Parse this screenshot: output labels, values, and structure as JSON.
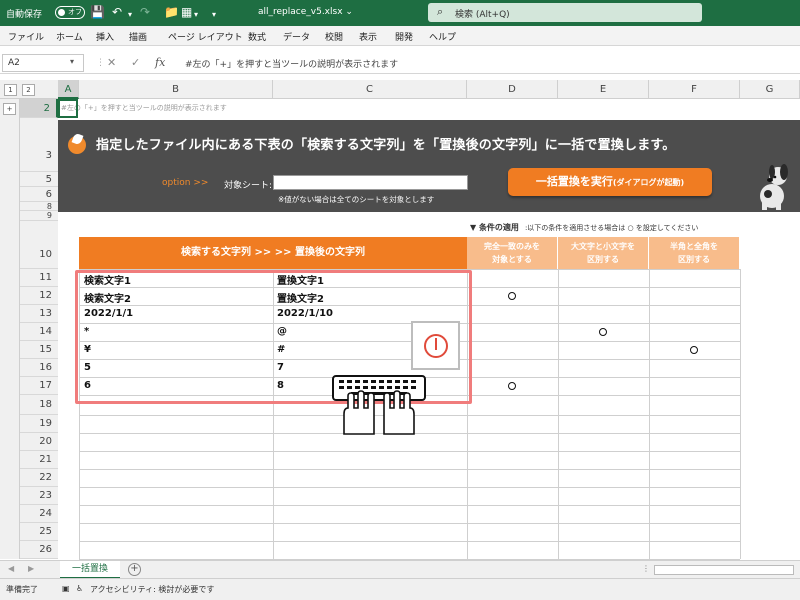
{
  "titlebar": {
    "autosave_label": "自動保存",
    "autosave_state": "オフ",
    "filename": "all_replace_v5.xlsx",
    "search_placeholder": "検索 (Alt+Q)"
  },
  "menu": [
    "ファイル",
    "ホーム",
    "挿入",
    "描画",
    "ページ レイアウト",
    "数式",
    "データ",
    "校閲",
    "表示",
    "開発",
    "ヘルプ"
  ],
  "formula_bar": {
    "name_box": "A2",
    "fx": "fx",
    "content": "#左の「+」を押すと当ツールの説明が表示されます"
  },
  "outline": {
    "level1": "1",
    "level2": "2",
    "expand": "+"
  },
  "columns": [
    "A",
    "B",
    "C",
    "D",
    "E",
    "F",
    "G"
  ],
  "rows": [
    "2",
    "3",
    "5",
    "6",
    "8",
    "9",
    "10",
    "11",
    "12",
    "13",
    "14",
    "15",
    "16",
    "17",
    "18",
    "19",
    "20",
    "21",
    "22",
    "23",
    "24",
    "25",
    "26"
  ],
  "sheet": {
    "a2_note": "#左の「+」を押すと当ツールの説明が表示されます",
    "heading": "指定したファイル内にある下表の「検索する文字列」を「置換後の文字列」に一括で置換します。",
    "option_label": "option >>",
    "target_sheet_label": "対象シート:",
    "target_sheet_hint": "※値がない場合は全てのシートを対象とします",
    "run_button": "一括置換を実行",
    "run_button_sub": "(ダイアログが起動)",
    "conditions_label": "▼ 条件の適用",
    "conditions_hint": ":以下の条件を適用させる場合は ○ を設定してください",
    "table_header": "検索する文字列 >> >> 置換後の文字列",
    "option_headers": [
      [
        "完全一致のみを",
        "対象とする"
      ],
      [
        "大文字と小文字を",
        "区別する"
      ],
      [
        "半角と全角を",
        "区別する"
      ]
    ],
    "table_rows": [
      {
        "search": "検索文字1",
        "replace": "置換文字1",
        "opts": [
          "",
          "",
          ""
        ]
      },
      {
        "search": "検索文字2",
        "replace": "置換文字2",
        "opts": [
          "○",
          "",
          ""
        ]
      },
      {
        "search": "2022/1/1",
        "replace": "2022/1/10",
        "opts": [
          "",
          "",
          ""
        ]
      },
      {
        "search": "*",
        "replace": "@",
        "opts": [
          "",
          "○",
          ""
        ]
      },
      {
        "search": "¥",
        "replace": "#",
        "opts": [
          "",
          "",
          "○"
        ]
      },
      {
        "search": "5",
        "replace": "7",
        "opts": [
          "",
          "",
          ""
        ]
      },
      {
        "search": "6",
        "replace": "8",
        "opts": [
          "○",
          "",
          ""
        ]
      }
    ]
  },
  "tabs": {
    "active": "一括置換",
    "add": "+"
  },
  "status": {
    "ready": "準備完了",
    "accessibility": "アクセシビリティ: 検討が必要です"
  },
  "colors": {
    "excel_green": "#1e6e42",
    "orange": "#f07c22",
    "light_orange": "#f8bc8b",
    "banner": "#4d4d4d",
    "highlight": "#f07c7c"
  }
}
